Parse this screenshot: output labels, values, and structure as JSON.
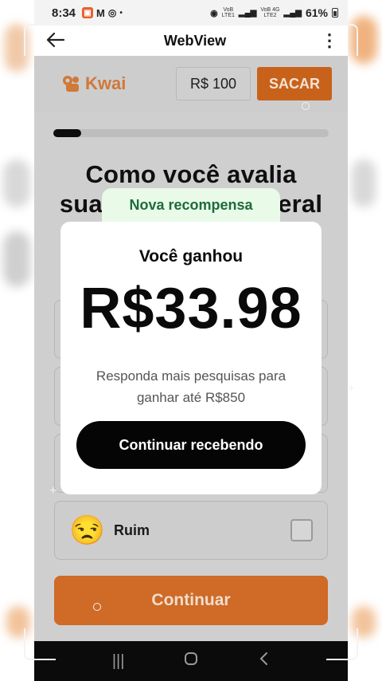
{
  "status_bar": {
    "time": "8:34",
    "battery": "61%",
    "sim1": "VoB\nLTE1",
    "sim2": "VoB 4G\nLTE2"
  },
  "app_bar": {
    "title": "WebView",
    "back_icon": "arrow-left-icon",
    "menu_icon": "more-vert-icon"
  },
  "header": {
    "brand": "Kwai",
    "balance": "R$ 100",
    "withdraw_label": "SACAR"
  },
  "survey": {
    "progress_fraction": 0.1,
    "question_line1": "Como você avalia",
    "question_line2": "sua                         eral",
    "options": [
      {
        "label": "Ruim",
        "emoji": "😒"
      }
    ],
    "continue_label": "Continuar"
  },
  "reward_modal": {
    "ribbon": "Nova recompensa",
    "heading": "Você ganhou",
    "amount": "R$33.98",
    "subtitle": "Responda mais pesquisas para ganhar até R$850",
    "cta_label": "Continuar recebendo"
  },
  "nav_bar": {
    "recents_icon": "recents-icon",
    "home_icon": "home-icon",
    "back_icon": "back-chevron-icon"
  },
  "colors": {
    "accent": "#c8621b",
    "ribbon_bg": "#e9fae9",
    "ribbon_text": "#1e6b3a"
  }
}
